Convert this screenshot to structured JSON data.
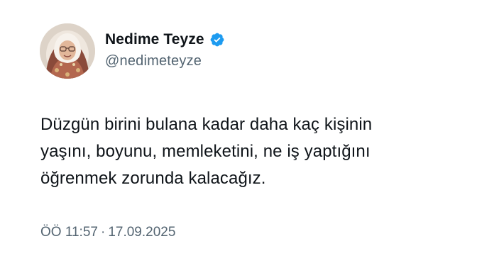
{
  "author": {
    "display_name": "Nedime Teyze",
    "handle": "@nedimeteyze",
    "verified_icon": "verified-badge-icon",
    "verified_color": "#1d9bf0"
  },
  "tweet": {
    "lines": [
      "Düzgün birini bulana kadar daha kaç kişinin",
      "yaşını, boyunu, memleketini, ne iş yaptığını",
      "öğrenmek zorunda kalacağız."
    ]
  },
  "meta": {
    "time": "ÖÖ 11:57",
    "separator": "·",
    "date": "17.09.2025"
  }
}
